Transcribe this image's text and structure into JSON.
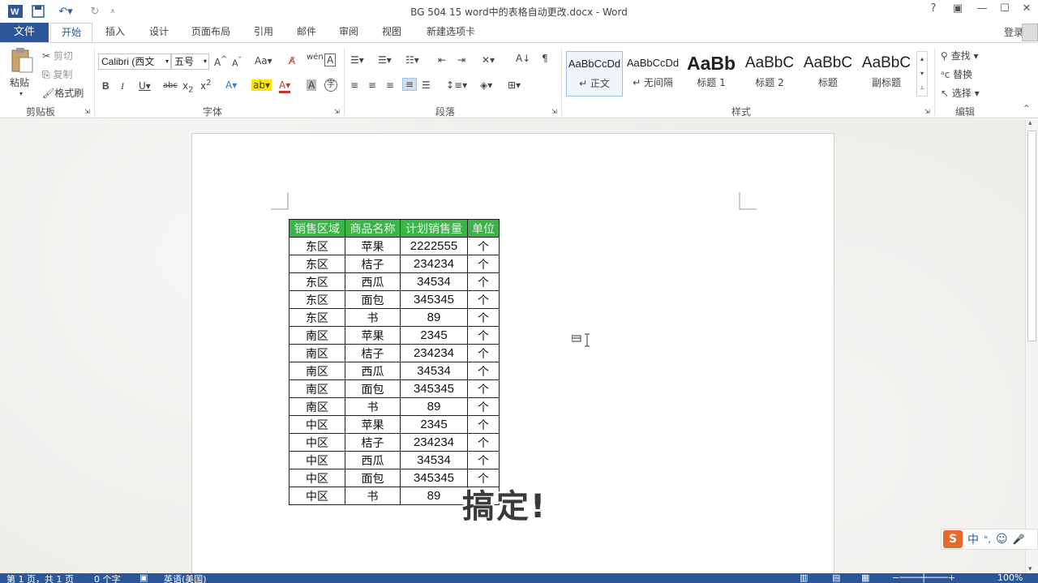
{
  "titlebar": {
    "doc_title": "BG 504 15 word中的表格自动更改.docx - Word",
    "help": "?",
    "restore_ribbon": "▣",
    "minimize": "—",
    "maximize": "☐",
    "close": "✕"
  },
  "tabs": {
    "file": "文件",
    "items": [
      "开始",
      "插入",
      "设计",
      "页面布局",
      "引用",
      "邮件",
      "审阅",
      "视图",
      "新建选项卡"
    ],
    "active": "开始",
    "login": "登录"
  },
  "ribbon": {
    "clipboard": {
      "label": "剪贴板",
      "paste": "粘贴",
      "cut": "剪切",
      "copy": "复制",
      "format_painter": "格式刷"
    },
    "font": {
      "label": "字体",
      "font_name": "Calibri (西文",
      "font_size": "五号"
    },
    "paragraph": {
      "label": "段落"
    },
    "styles": {
      "label": "样式",
      "items": [
        {
          "preview": "AaBbCcDd",
          "name": "↵ 正文"
        },
        {
          "preview": "AaBbCcDd",
          "name": "↵ 无间隔"
        },
        {
          "preview": "AaBb",
          "name": "标题 1"
        },
        {
          "preview": "AaBbC",
          "name": "标题 2"
        },
        {
          "preview": "AaBbC",
          "name": "标题"
        },
        {
          "preview": "AaBbC",
          "name": "副标题"
        }
      ]
    },
    "editing": {
      "label": "编辑",
      "find": "查找",
      "replace": "替换",
      "select": "选择"
    }
  },
  "table": {
    "headers": [
      "销售区域",
      "商品名称",
      "计划销售量",
      "单位"
    ],
    "rows": [
      [
        "东区",
        "苹果",
        "2222555",
        "个"
      ],
      [
        "东区",
        "桔子",
        "234234",
        "个"
      ],
      [
        "东区",
        "西瓜",
        "34534",
        "个"
      ],
      [
        "东区",
        "面包",
        "345345",
        "个"
      ],
      [
        "东区",
        "书",
        "89",
        "个"
      ],
      [
        "南区",
        "苹果",
        "2345",
        "个"
      ],
      [
        "南区",
        "桔子",
        "234234",
        "个"
      ],
      [
        "南区",
        "西瓜",
        "34534",
        "个"
      ],
      [
        "南区",
        "面包",
        "345345",
        "个"
      ],
      [
        "南区",
        "书",
        "89",
        "个"
      ],
      [
        "中区",
        "苹果",
        "2345",
        "个"
      ],
      [
        "中区",
        "桔子",
        "234234",
        "个"
      ],
      [
        "中区",
        "西瓜",
        "34534",
        "个"
      ],
      [
        "中区",
        "面包",
        "345345",
        "个"
      ],
      [
        "中区",
        "书",
        "89",
        "个"
      ]
    ]
  },
  "caption": "搞定!",
  "ime": {
    "logo": "S",
    "mode": "中",
    "punct": "°,",
    "emoji": "☺",
    "mic": "🎤"
  },
  "statusbar": {
    "page": "第 1 页，共 1 页",
    "words": "0 个字",
    "language": "英语(美国)",
    "zoom": "100%"
  },
  "colors": {
    "accent": "#2b579a",
    "table_header": "#3cb44a",
    "ime_logo": "#e9682a"
  }
}
